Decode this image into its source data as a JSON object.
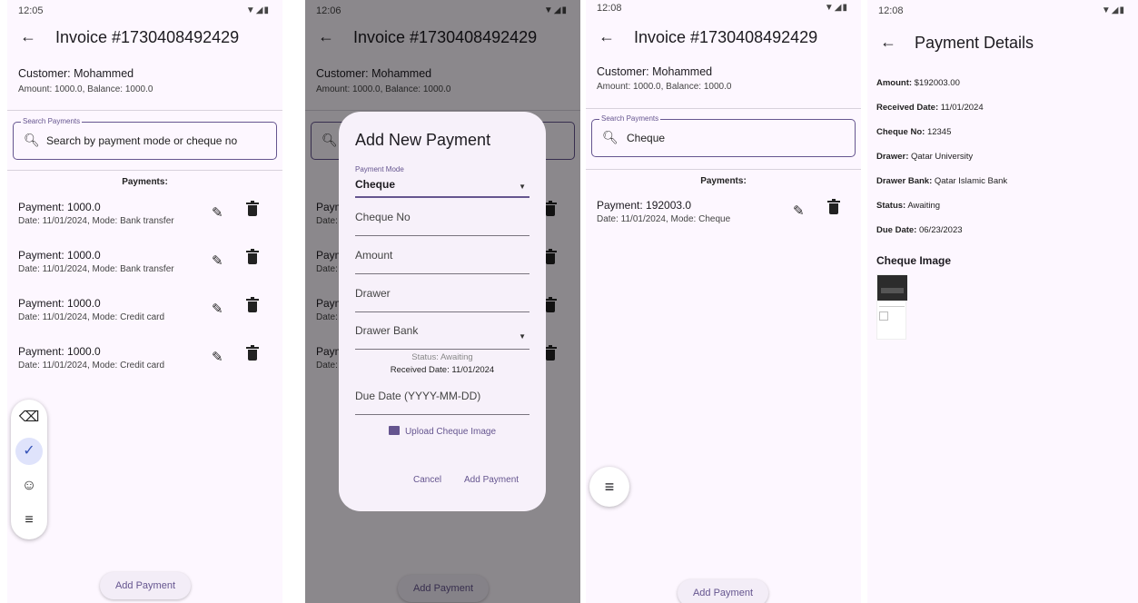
{
  "screen1": {
    "time": "12:05",
    "title": "Invoice #1730408492429",
    "customer": "Customer: Mohammed",
    "amount_line": "Amount: 1000.0, Balance: 1000.0",
    "search_label": "Search Payments",
    "search_placeholder": "Search by payment mode or cheque no",
    "payments_header": "Payments:",
    "payments": [
      {
        "payment": "Payment: 1000.0",
        "detail": "Date: 11/01/2024, Mode: Bank transfer"
      },
      {
        "payment": "Payment: 1000.0",
        "detail": "Date: 11/01/2024, Mode: Bank transfer"
      },
      {
        "payment": "Payment: 1000.0",
        "detail": "Date: 11/01/2024, Mode: Credit card"
      },
      {
        "payment": "Payment: 1000.0",
        "detail": "Date: 11/01/2024, Mode: Credit card"
      }
    ],
    "add_payment": "Add Payment"
  },
  "screen2": {
    "time": "12:06",
    "title": "Invoice #1730408492429",
    "customer": "Customer: Mohammed",
    "amount_line": "Amount: 1000.0, Balance: 1000.0",
    "payments_partial": [
      "Paym",
      "Paym",
      "Paym",
      "Paym"
    ],
    "dates_partial": [
      "Date:",
      "Date:",
      "Date:",
      "Date:"
    ],
    "add_payment": "Add Payment",
    "dialog": {
      "title": "Add New Payment",
      "mode_label": "Payment Mode",
      "mode_value": "Cheque",
      "cheque_no": "Cheque No",
      "amount": "Amount",
      "drawer": "Drawer",
      "drawer_bank": "Drawer Bank",
      "status": "Status: Awaiting",
      "received": "Received Date: 11/01/2024",
      "due_date": "Due Date (YYYY-MM-DD)",
      "upload": "Upload Cheque Image",
      "cancel": "Cancel",
      "submit": "Add Payment"
    }
  },
  "screen3": {
    "time": "12:08",
    "title": "Invoice #1730408492429",
    "customer": "Customer: Mohammed",
    "amount_line": "Amount: 1000.0, Balance: 1000.0",
    "search_label": "Search Payments",
    "search_value": "Cheque",
    "payments_header": "Payments:",
    "payment": "Payment: 192003.0",
    "payment_detail": "Date: 11/01/2024, Mode: Cheque",
    "add_payment": "Add Payment"
  },
  "screen4": {
    "time": "12:08",
    "title": "Payment Details",
    "details": [
      {
        "label": "Amount:",
        "value": " $192003.00"
      },
      {
        "label": "Received Date:",
        "value": " 11/01/2024"
      },
      {
        "label": "Cheque No:",
        "value": " 12345"
      },
      {
        "label": "Drawer:",
        "value": " Qatar University"
      },
      {
        "label": "Drawer Bank:",
        "value": " Qatar Islamic Bank"
      },
      {
        "label": "Status:",
        "value": " Awaiting"
      },
      {
        "label": "Due Date:",
        "value": " 06/23/2023"
      }
    ],
    "cheque_image_heading": "Cheque Image"
  },
  "colors": {
    "background": "#fdf7ff",
    "accent": "#65558f",
    "dialog_surface": "#f7f1fa"
  }
}
